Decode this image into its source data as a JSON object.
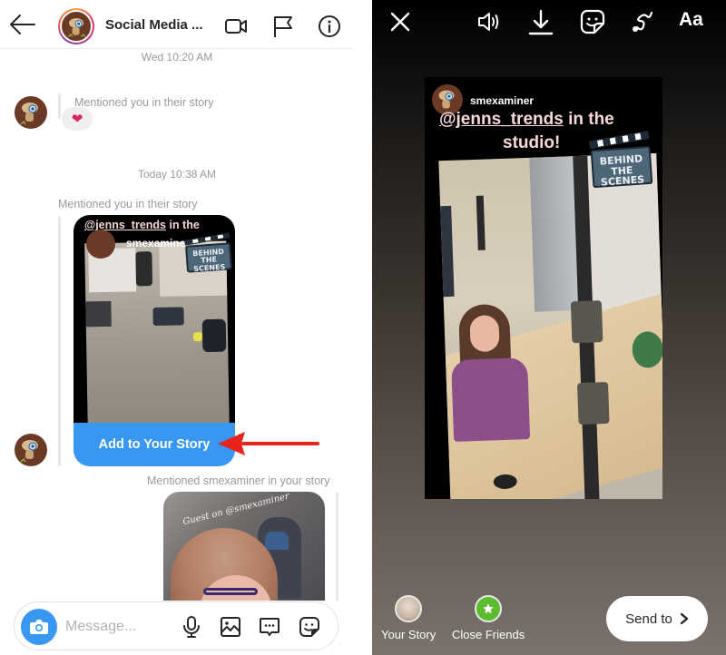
{
  "left_panel": {
    "header": {
      "title": "Social Media ...",
      "icons": [
        "back-arrow-icon",
        "video-call-icon",
        "flag-icon",
        "info-icon"
      ]
    },
    "thread": {
      "timestamp_1": "Wed 10:20 AM",
      "message_1": {
        "label": "Mentioned you in their story",
        "reaction": "❤"
      },
      "timestamp_2": "Today 10:38 AM",
      "message_2": {
        "label": "Mentioned you in their story",
        "story_title_prefix": "@jenns_trends",
        "story_title_suffix": " in the",
        "story_username": "smexaminer",
        "sticker_line_1": "BEHIND THE",
        "sticker_line_2": "SCENES",
        "action_button": "Add to Your Story"
      },
      "message_3": {
        "label": "Mentioned smexaminer in your story",
        "story_overlay_text": "Guest on @smexaminer"
      }
    },
    "composer": {
      "placeholder": "Message...",
      "value": "",
      "icons": [
        "camera-icon",
        "microphone-icon",
        "gallery-icon",
        "chat-bubble-icon",
        "sticker-icon"
      ]
    },
    "annotation": {
      "arrow_color": "#e8231a"
    }
  },
  "right_panel": {
    "toolbar": {
      "close_icon": "close-icon",
      "sound_icon": "speaker-icon",
      "download_icon": "download-icon",
      "sticker_icon": "sticker-icon",
      "draw_icon": "draw-icon",
      "text_label": "Aa"
    },
    "story": {
      "username": "smexaminer",
      "title_mention": "@jenns_trends",
      "title_rest": " in the",
      "title_line2": "studio!",
      "sticker_line_1": "BEHIND THE",
      "sticker_line_2": "SCENES"
    },
    "bottom": {
      "your_story_label": "Your Story",
      "close_friends_label": "Close Friends",
      "send_to_label": "Send to",
      "send_to_chevron": "›"
    }
  },
  "colors": {
    "accent_blue": "#3897f0",
    "close_friends_green": "#5dbb2f",
    "mention_text_pink": "#f6d8d8",
    "timestamp_gray": "#9a9a9a"
  }
}
